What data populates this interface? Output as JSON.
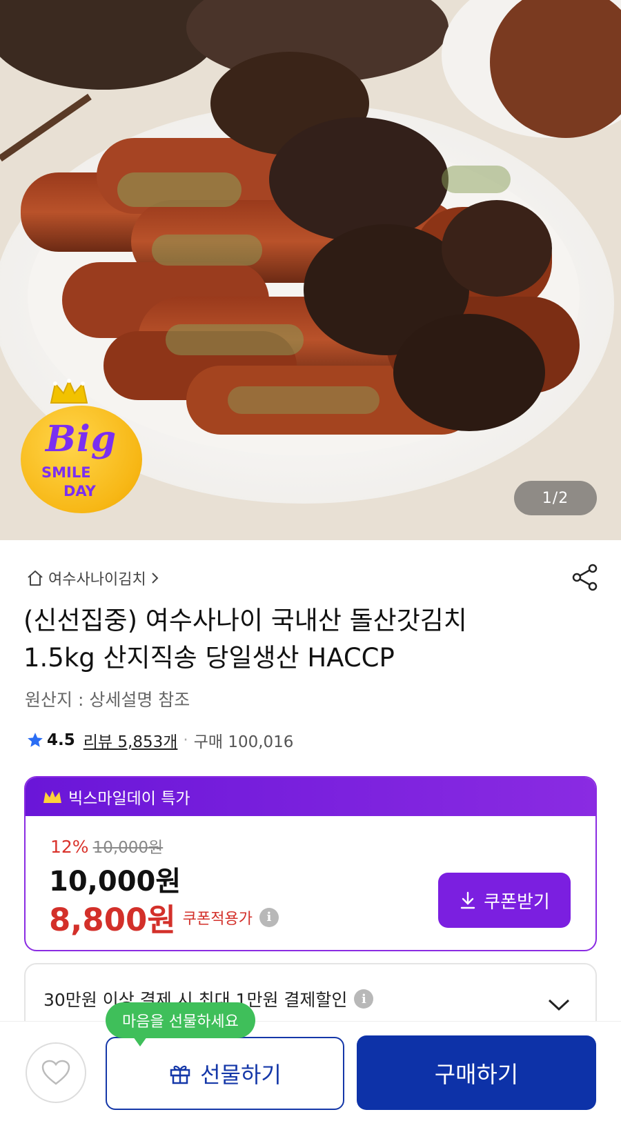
{
  "hero": {
    "image_counter": "1/2",
    "badge": {
      "line1": "Big",
      "line2": "SMILE",
      "line3": "DAY"
    }
  },
  "product": {
    "store_name": "여수사나이김치",
    "title_line1": "(신선집중) 여수사나이 국내산 돌산갓김치",
    "title_line2": "1.5kg 산지직송 당일생산 HACCP",
    "origin": "원산지 : 상세설명 참조",
    "rating": "4.5",
    "reviews": "리뷰 5,853개",
    "purchases": "구매 100,016"
  },
  "deal": {
    "header_label": "빅스마일데이 특가",
    "discount_pct": "12%",
    "original_price": "10,000원",
    "price": "10,000원",
    "coupon_price": "8,800원",
    "coupon_price_label": "쿠폰적용가",
    "coupon_button": "쿠폰받기"
  },
  "promo": {
    "text": "30만원 이상 결제 시 최대 1만원 결제할인"
  },
  "bottom_bar": {
    "tooltip": "마음을 선물하세요",
    "gift_button": "선물하기",
    "buy_button": "구매하기"
  },
  "colors": {
    "purple": "#7b1fe0",
    "red_price": "#d3302a",
    "navy": "#0d32a8",
    "green_tooltip": "#3fbf5a"
  }
}
